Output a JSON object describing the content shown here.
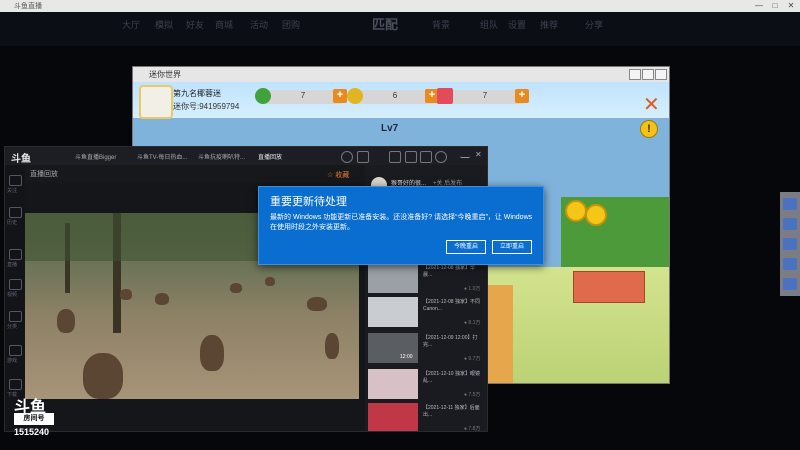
{
  "outer": {
    "title": "斗鱼直播",
    "controls": [
      "—",
      "□",
      "✕"
    ]
  },
  "topnav": {
    "items": [
      "大厅",
      "模拟",
      "好友",
      "商城",
      "活动",
      "团购"
    ],
    "match": "匹配",
    "right": [
      "背景",
      "组队",
      "设置",
      "推荐",
      "分享"
    ]
  },
  "game": {
    "title": "迷你世界",
    "player_name": "第九名椰蓉迷",
    "player_id": "迷你号:941959794",
    "resources": [
      {
        "name": "mini-bean",
        "value": "7",
        "color": "#3fa23a"
      },
      {
        "name": "mini-coin",
        "value": "6",
        "color": "#e0b422"
      },
      {
        "name": "ticket",
        "value": "7",
        "color": "#e34a5a"
      }
    ],
    "level": "Lv7"
  },
  "douyu": {
    "logo": "斗鱼",
    "tabs": [
      "斗鱼直播Bigger",
      "斗鱼TV-每日热血...",
      "斗鱼抗疫喇叭特...",
      "直播回放"
    ],
    "breadcrumb": "直播回放",
    "star_label": "收藏",
    "uploader_name": "猴哥好的很...",
    "uploader_follow": "+关 后发布",
    "side_labels": [
      "关注",
      "历史",
      "直播",
      "视频",
      "分类",
      "游戏",
      "下载"
    ],
    "related": [
      {
        "text": "【2021-12-08 独家】早晨...",
        "count": "● 1.0万",
        "color": "#9aa0a6"
      },
      {
        "text": "【2021-12-08 独家】不同Canon...",
        "count": "● 8.1万",
        "color": "#c9ccd0"
      },
      {
        "text": "【2021-12-09 12:00】打完...",
        "count": "● 9.7万",
        "color": "#5a5d62"
      },
      {
        "text": "【2021-12-10 独家】眼镜乱...",
        "count": "● 7.5万",
        "color": "#d7c0c6"
      },
      {
        "text": "【2021-12-11 独家】后面出...",
        "count": "● 7.8万",
        "color": "#c03848"
      }
    ],
    "video_time": "12:00"
  },
  "dialog": {
    "title": "重要更新待处理",
    "body": "最新的 Windows 功能更新已准备安装。还没准备好? 请选择“今晚重启”，让 Windows 在使用时段之外安装更新。",
    "later_button": "今晚重启",
    "now_button": "立即重启"
  },
  "watermark": {
    "logo": "斗鱼",
    "sub": "房间号",
    "room": "1515240"
  }
}
